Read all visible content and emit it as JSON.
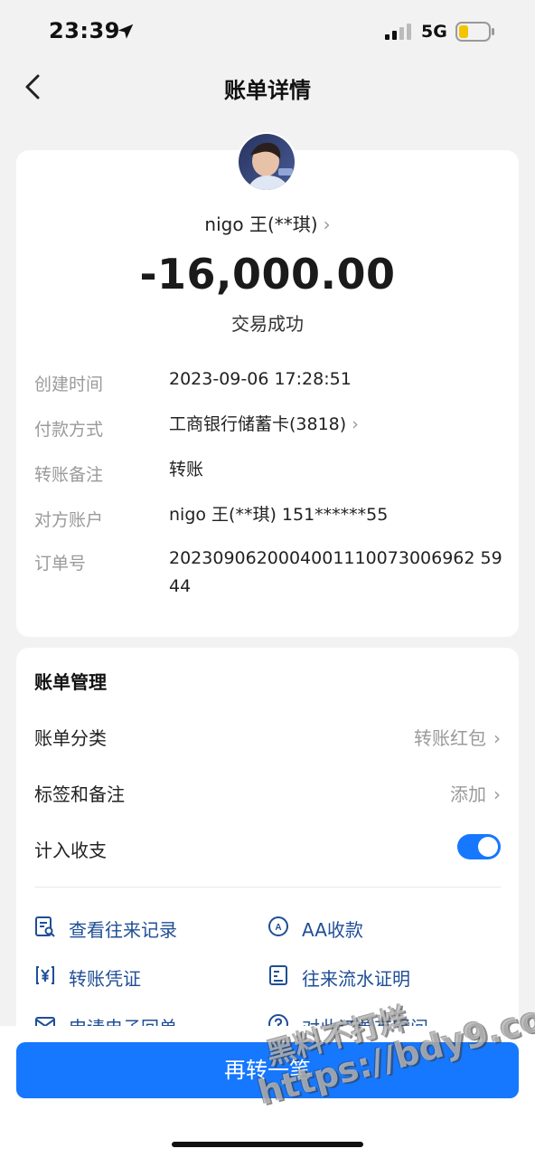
{
  "status_bar": {
    "time": "23:39",
    "network": "5G",
    "icons": [
      "location-arrow-icon",
      "signal-bars-icon",
      "battery-low-icon"
    ]
  },
  "nav": {
    "title": "账单详情",
    "back_icon": "back-chevron-icon"
  },
  "transaction": {
    "payee": "nigo 王(**琪)",
    "amount": "-16,000.00",
    "status": "交易成功",
    "details": [
      {
        "label": "创建时间",
        "value": "2023-09-06 17:28:51"
      },
      {
        "label": "付款方式",
        "value": "工商银行储蓄卡(3818)"
      },
      {
        "label": "转账备注",
        "value": "转账"
      },
      {
        "label": "对方账户",
        "value": "nigo 王(**琪) 151******55"
      },
      {
        "label": "订单号",
        "value": "2023090620004001110073006962 5944"
      }
    ]
  },
  "management": {
    "title": "账单管理",
    "category": {
      "label": "账单分类",
      "value": "转账红包"
    },
    "tags": {
      "label": "标签和备注",
      "value": "添加"
    },
    "include": {
      "label": "计入收支",
      "enabled": true
    },
    "actions": [
      {
        "label": "查看往来记录",
        "icon": "records-search-icon"
      },
      {
        "label": "AA收款",
        "icon": "aa-collect-icon"
      },
      {
        "label": "转账凭证",
        "icon": "yuan-voucher-icon"
      },
      {
        "label": "往来流水证明",
        "icon": "statement-proof-icon"
      },
      {
        "label": "申请电子回单",
        "icon": "mail-receipt-icon"
      },
      {
        "label": "对此订单有疑问",
        "icon": "question-icon"
      }
    ]
  },
  "bottom_button": {
    "label": "再转一笔"
  },
  "watermark": {
    "line1": "黑料不打烊",
    "line2": "https://bdy9.co"
  },
  "colors": {
    "accent": "#1677ff",
    "link": "#1f4e96",
    "muted": "#9a9a9a"
  }
}
